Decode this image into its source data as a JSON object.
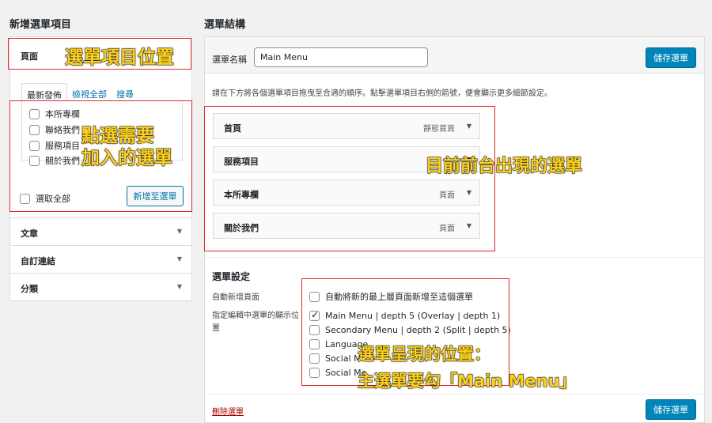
{
  "left": {
    "heading": "新增選單項目",
    "pages_title": "頁面",
    "tabs": [
      "最新發佈",
      "檢視全部",
      "搜尋"
    ],
    "pages": [
      "本所專欄",
      "聯絡我們",
      "服務項目",
      "關於我們"
    ],
    "select_all": "選取全部",
    "add_button": "新增至選單",
    "sections": [
      "文章",
      "自訂連結",
      "分類"
    ]
  },
  "right": {
    "heading": "選單結構",
    "name_label": "選單名稱",
    "name_value": "Main Menu",
    "save_button": "儲存選單",
    "instructions": "請在下方將各個選單項目拖曳至合適的順序。點擊選單項目右側的箭號，便會顯示更多細節設定。",
    "items": [
      {
        "name": "首頁",
        "type": "靜態首頁"
      },
      {
        "name": "服務項目",
        "type": ""
      },
      {
        "name": "本所專欄",
        "type": "頁面"
      },
      {
        "name": "關於我們",
        "type": "頁面"
      }
    ],
    "settings_heading": "選單設定",
    "auto_add_label": "自動新增頁面",
    "auto_add_option": "自動將新的最上層頁面新增至這個選單",
    "location_label": "指定編輯中選單的顯示位置",
    "locations": [
      {
        "label": "Main Menu | depth 5 (Overlay | depth 1)",
        "checked": true
      },
      {
        "label": "Secondary Menu | depth 2 (Split | depth 5)",
        "checked": false
      },
      {
        "label": "Language",
        "checked": false
      },
      {
        "label": "Social Me",
        "checked": false
      },
      {
        "label": "Social Me",
        "checked": false
      }
    ],
    "delete_link": "刪除選單",
    "save_button_bottom": "儲存選單"
  },
  "annotations": {
    "position": "選單項目位置",
    "select_line1": "點選需要",
    "select_line2": "加入的選單",
    "current": "目前前台出現的選單",
    "location_line1": "選單呈現的位置：",
    "location_line2": "主選單要勾「Main Menu」"
  },
  "colors": {
    "accent": "#0085ba",
    "annotation": "#ffd21a",
    "highlight": "#e0262b",
    "link": "#0073aa",
    "delete": "#a00"
  }
}
